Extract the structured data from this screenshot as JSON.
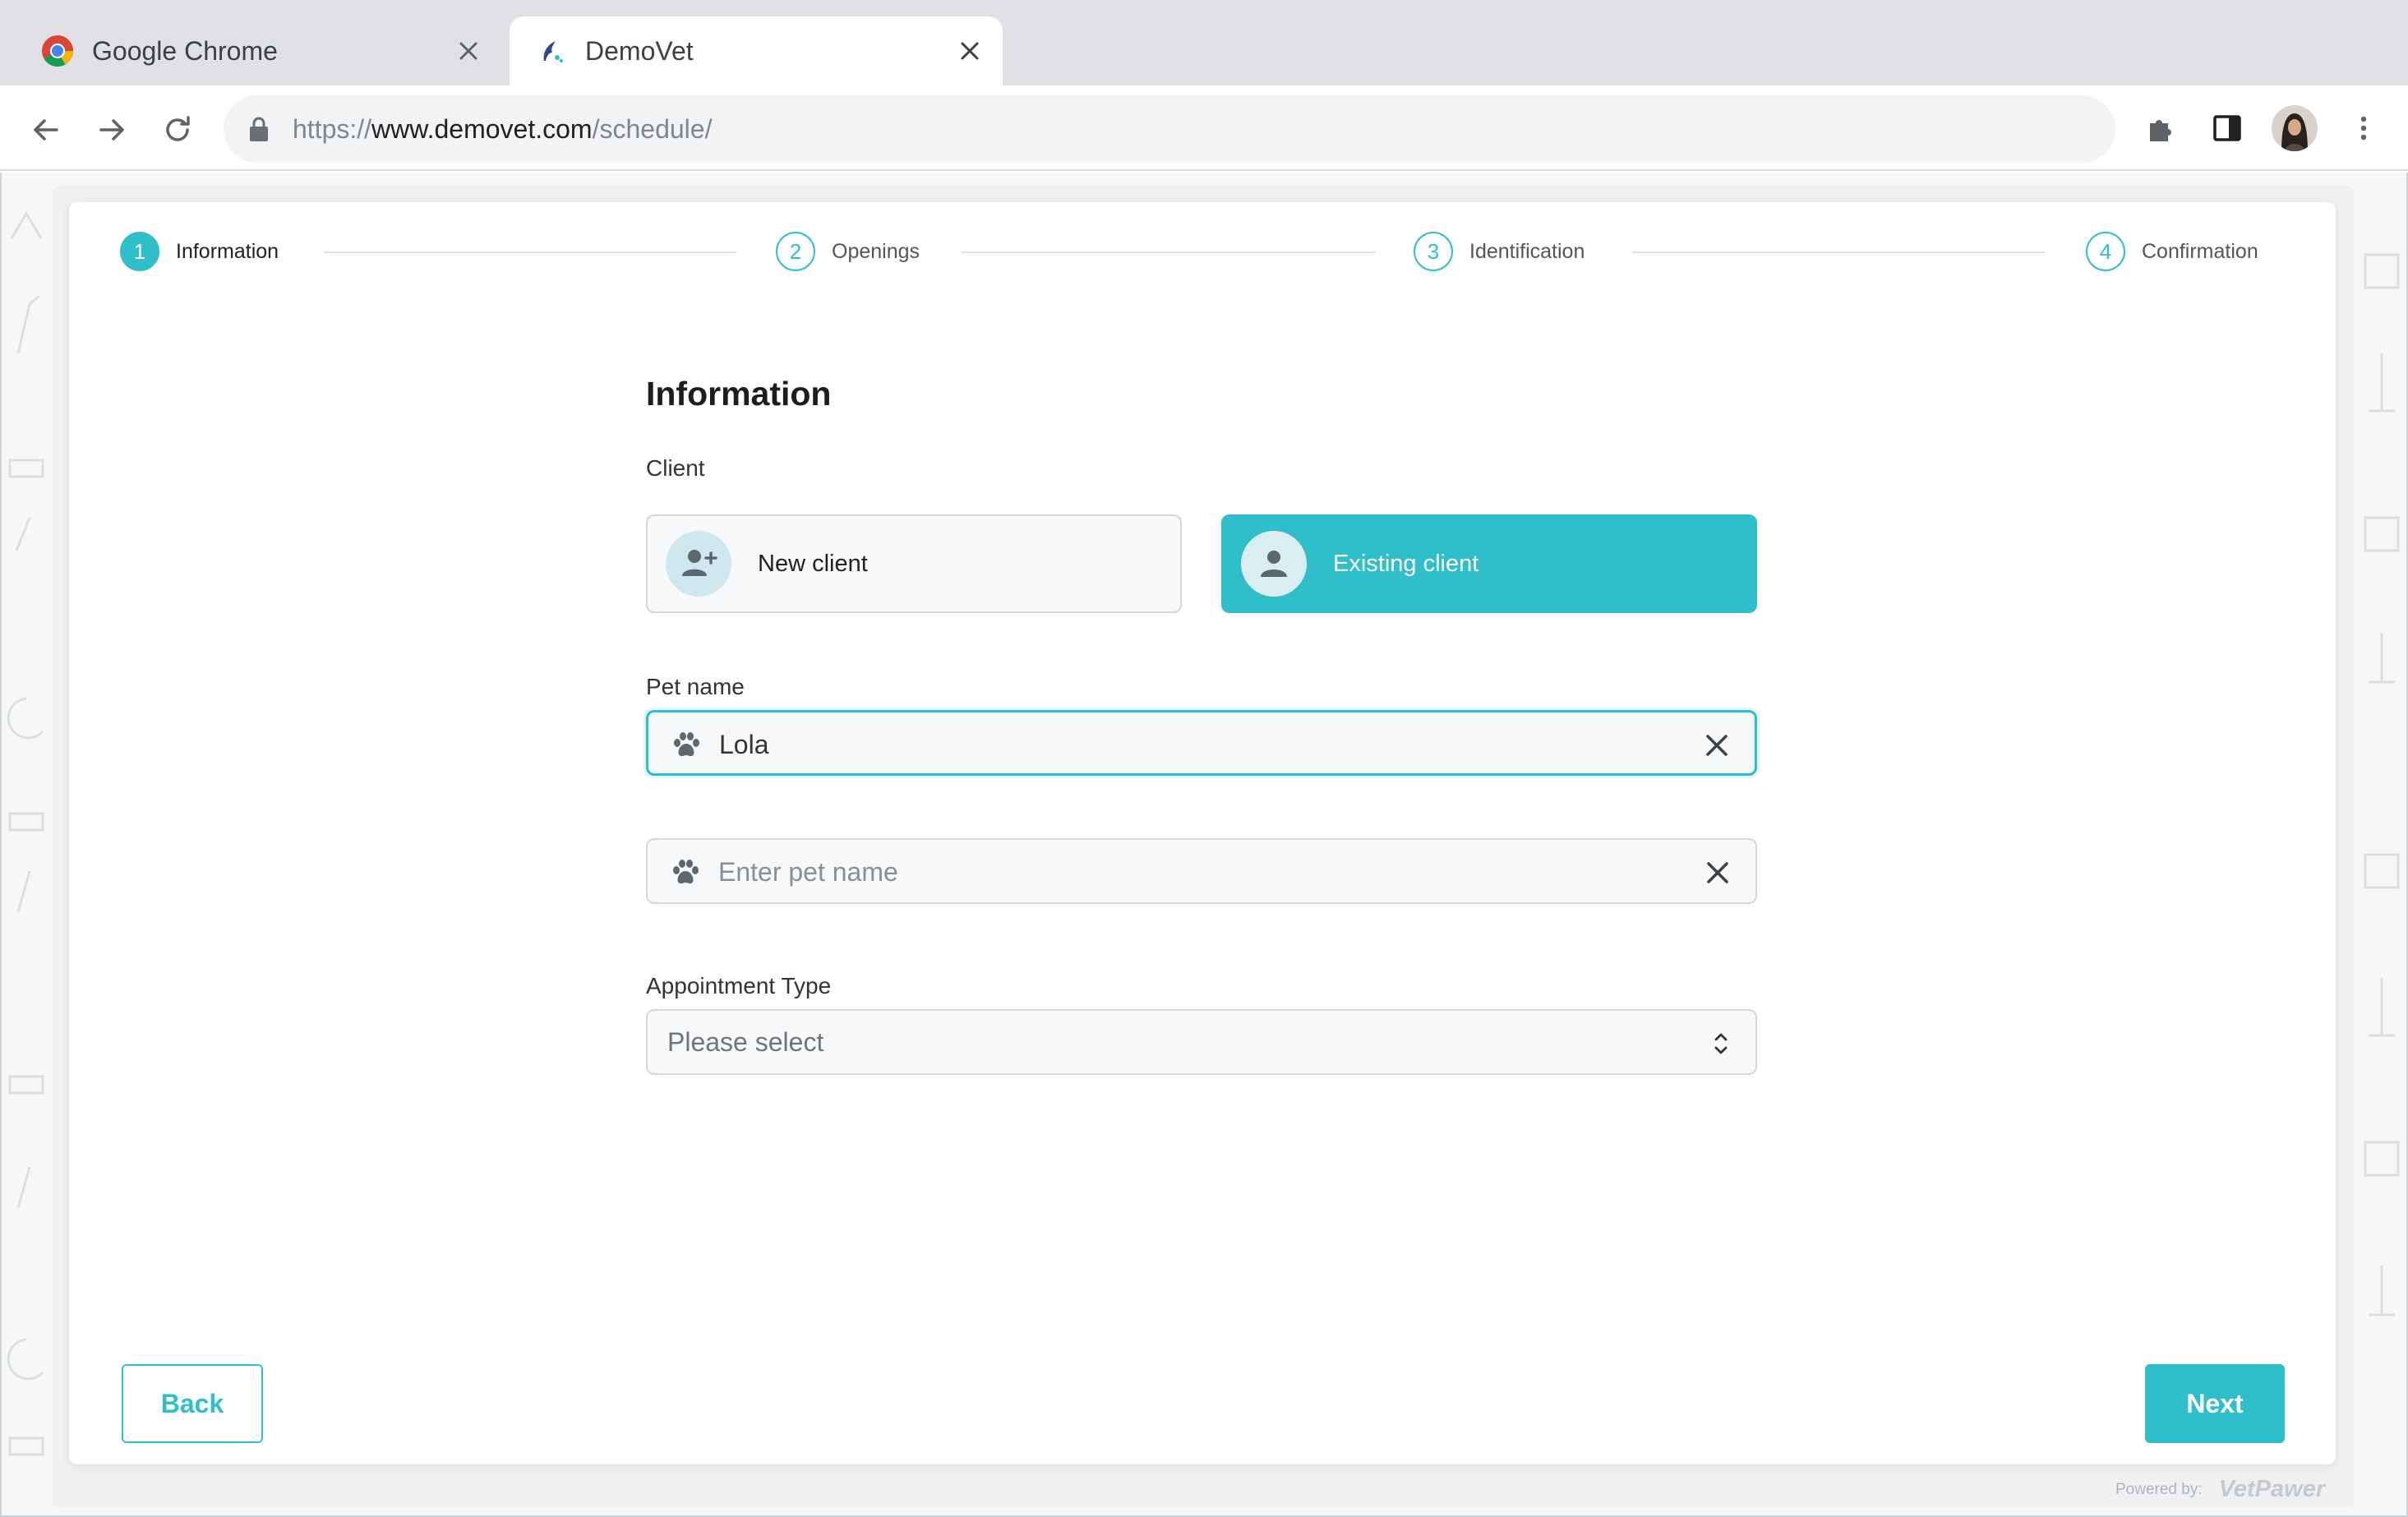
{
  "browser": {
    "tabs": [
      {
        "title": "Google Chrome",
        "active": false,
        "icon": "chrome-icon"
      },
      {
        "title": "DemoVet",
        "active": true,
        "icon": "demovet-favicon"
      }
    ],
    "url": {
      "scheme": "https://",
      "host": "www.demovet.com",
      "path": "/schedule/"
    }
  },
  "stepper": {
    "steps": [
      {
        "number": "1",
        "label": "Information",
        "active": true
      },
      {
        "number": "2",
        "label": "Openings",
        "active": false
      },
      {
        "number": "3",
        "label": "Identification",
        "active": false
      },
      {
        "number": "4",
        "label": "Confirmation",
        "active": false
      }
    ]
  },
  "form": {
    "title": "Information",
    "client_label": "Client",
    "new_client_label": "New client",
    "existing_client_label": "Existing client",
    "selected_client": "existing",
    "pet_name_label": "Pet name",
    "pet_name_value": "Lola",
    "pet_name_placeholder": "Enter pet name",
    "appointment_type_label": "Appointment Type",
    "appointment_type_placeholder": "Please select"
  },
  "footer": {
    "back_label": "Back",
    "next_label": "Next",
    "powered_by_label": "Powered by:",
    "powered_by_brand": "VetPawer"
  },
  "colors": {
    "accent": "#2ebfcb",
    "tabbar": "#dfe1e5"
  }
}
